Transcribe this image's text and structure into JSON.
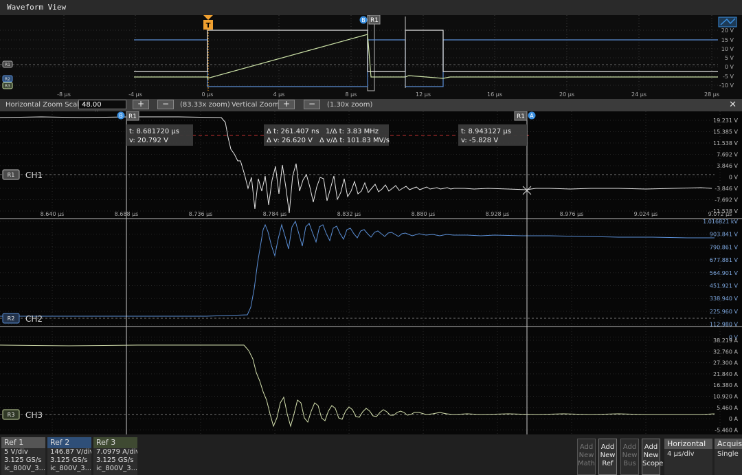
{
  "title": "Waveform View",
  "overview": {
    "time_ticks": [
      "-8 µs",
      "-4 µs",
      "0 µs",
      "4 µs",
      "8 µs",
      "12 µs",
      "16 µs",
      "20 µs",
      "24 µs",
      "28 µs"
    ],
    "volt_ticks": [
      "20 V",
      "15 V",
      "10 V",
      "5 V",
      "0 V",
      "-5 V",
      "-10 V"
    ],
    "trigger_label": "T",
    "cursor_b_label": "B",
    "cursor_r1_label": "R1",
    "ref_markers": [
      "R1",
      "R2",
      "R3"
    ]
  },
  "zoombar": {
    "h_label": "Horizontal Zoom Scale",
    "h_value": "48.00 ns/div",
    "plus": "+",
    "minus": "−",
    "h_zoom": "(83.33x zoom)",
    "v_label": "Vertical Zoom",
    "v_zoom": "(1.30x zoom)",
    "close": "✕"
  },
  "main": {
    "time_ticks": [
      "8.640 µs",
      "8.688 µs",
      "8.736 µs",
      "8.784 µs",
      "8.832 µs",
      "8.880 µs",
      "8.928 µs",
      "8.976 µs",
      "9.024 µs",
      "9.072 µs"
    ],
    "cursor_left_label": "R1",
    "cursor_left_badge": "B",
    "cursor_right_label": "R1",
    "cursor_right_badge": "A",
    "readout_left": {
      "t": "t: 8.681720 µs",
      "v": "v: 20.792 V"
    },
    "readout_mid": {
      "dt": "Δ t:  261.407 ns",
      "inv_dt": "1/Δ t:  3.83 MHz",
      "dv": "Δ v:  26.620 V",
      "dvdt": "Δ v/Δ t:  101.83 MV/s"
    },
    "readout_right": {
      "t": "t: 8.943127 µs",
      "v": "v: -5.828 V"
    },
    "ch1": {
      "ref": "R1",
      "name": "CH1",
      "ticks": [
        "19.231 V",
        "15.385 V",
        "11.538 V",
        "7.692 V",
        "3.846 V",
        "0 V",
        "-3.846 V",
        "-7.692 V",
        "-11.538 V"
      ]
    },
    "ch2": {
      "ref": "R2",
      "name": "CH2",
      "ticks": [
        "1.016821 kV",
        "903.841 V",
        "790.861 V",
        "677.881 V",
        "564.901 V",
        "451.921 V",
        "338.940 V",
        "225.960 V",
        "112.980 V",
        "0 V"
      ]
    },
    "ch3": {
      "ref": "R3",
      "name": "CH3",
      "ticks": [
        "38.219 A",
        "32.760 A",
        "27.300 A",
        "21.840 A",
        "16.380 A",
        "10.920 A",
        "5.460 A",
        "0 A",
        "-5.460 A"
      ]
    }
  },
  "bottom": {
    "refs": [
      {
        "name": "Ref 1",
        "scale": "5 V/div",
        "rate": "3.125 GS/s",
        "file": "ic_800V_3..."
      },
      {
        "name": "Ref 2",
        "scale": "146.87 V/div",
        "rate": "3.125 GS/s",
        "file": "ic_800V_3..."
      },
      {
        "name": "Ref 3",
        "scale": "7.0979 A/div",
        "rate": "3.125 GS/s",
        "file": "ic_800V_3..."
      }
    ],
    "add_buttons": [
      {
        "l1": "Add",
        "l2": "New",
        "l3": "Math"
      },
      {
        "l1": "Add",
        "l2": "New",
        "l3": "Ref"
      },
      {
        "l1": "Add",
        "l2": "New",
        "l3": "Bus"
      },
      {
        "l1": "Add",
        "l2": "New",
        "l3": "Scope"
      }
    ],
    "horizontal": {
      "title": "Horizontal",
      "value": "4 µs/div"
    },
    "acquisition": {
      "title": "Acquisition",
      "value": "Single"
    }
  },
  "colors": {
    "ch1": "#e6e6e6",
    "ch2": "#5b8fd6",
    "ch3": "#d7e3b0",
    "trigger": "#f0a030",
    "ref2_header": "#2f4f78",
    "ref1_header": "#555555"
  }
}
